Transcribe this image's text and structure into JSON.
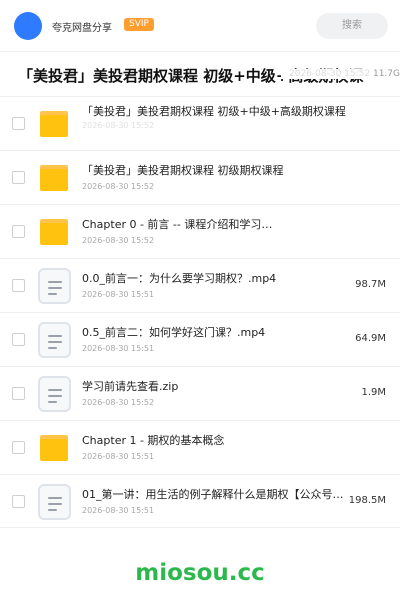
{
  "header": {
    "app_name": "夸克网盘分享",
    "badge": "SVIP",
    "search_label": "搜索"
  },
  "page": {
    "title": "「美投君」美投君期权课程 初级+中级+高级期权课",
    "meta_date": "2026-08-30 15:52",
    "meta_size": "11.7G"
  },
  "files": [
    {
      "name": "「美投君」美投君期权课程 初级+中级+高级期权课程",
      "date": "2026-08-30 15:52",
      "size": "",
      "type": "folder"
    },
    {
      "name": "「美投君」美投君期权课程 初级期权课程",
      "date": "2026-08-30 15:52",
      "size": "",
      "type": "folder"
    },
    {
      "name": "Chapter 0 - 前言 -- 课程介绍和学习…",
      "date": "2026-08-30 15:52",
      "size": "",
      "type": "folder"
    },
    {
      "name": "0.0_前言一：为什么要学习期权？.mp4",
      "date": "2026-08-30 15:51",
      "size": "98.7M",
      "type": "file"
    },
    {
      "name": "0.5_前言二：如何学好这门课？.mp4",
      "date": "2026-08-30 15:51",
      "size": "64.9M",
      "type": "file"
    },
    {
      "name": "学习前请先查看.zip",
      "date": "2026-08-30 15:52",
      "size": "1.9M",
      "type": "file"
    },
    {
      "name": "Chapter 1 - 期权的基本概念",
      "date": "2026-08-30 15:51",
      "size": "",
      "type": "folder"
    },
    {
      "name": "01_第一讲：用生活的例子解释什么是期权【公众号：…",
      "date": "2026-08-30 15:51",
      "size": "198.5M",
      "type": "file"
    }
  ],
  "watermark": "miosou.cc",
  "colors": {
    "accent": "#2f7bff",
    "badge": "#ff9d2e",
    "folder": "#ffc20e",
    "watermark": "#2db84d"
  },
  "icons": {
    "folder": "folder-icon",
    "file": "document-icon"
  }
}
